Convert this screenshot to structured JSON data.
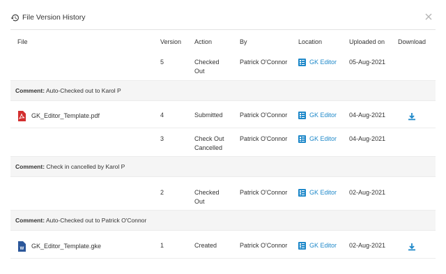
{
  "dialog": {
    "title": "File Version History"
  },
  "table": {
    "columns": [
      "File",
      "Version",
      "Action",
      "By",
      "Location",
      "Uploaded on",
      "Download"
    ],
    "rows": [
      {
        "file": "",
        "version": "5",
        "action_line1": "Checked",
        "action_line2": "Out",
        "by": "Patrick O'Connor",
        "location": "GK Editor",
        "uploaded": "05-Aug-2021",
        "comment_label": "Comment:",
        "comment": "Auto-Checked out to Karol P"
      },
      {
        "file": "GK_Editor_Template.pdf",
        "file_type": "pdf-icon",
        "version": "4",
        "action_line1": "Submitted",
        "action_line2": "",
        "by": "Patrick O'Connor",
        "location": "GK Editor",
        "uploaded": "04-Aug-2021",
        "download": "download-icon"
      },
      {
        "file": "",
        "version": "3",
        "action_line1": "Check Out",
        "action_line2": "Cancelled",
        "by": "Patrick O'Connor",
        "location": "GK Editor",
        "uploaded": "04-Aug-2021",
        "comment_label": "Comment:",
        "comment": "Check in cancelled by Karol P"
      },
      {
        "file": "",
        "version": "2",
        "action_line1": "Checked",
        "action_line2": "Out",
        "by": "Patrick O'Connor",
        "location": "GK Editor",
        "uploaded": "02-Aug-2021",
        "comment_label": "Comment:",
        "comment": "Auto-Checked out to Patrick O'Connor"
      },
      {
        "file": "GK_Editor_Template.gke",
        "file_type": "word-icon",
        "version": "1",
        "action_line1": "Created",
        "action_line2": "",
        "by": "Patrick O'Connor",
        "location": "GK Editor",
        "uploaded": "02-Aug-2021",
        "download": "download-icon"
      }
    ]
  },
  "colors": {
    "accent": "#1e88c9",
    "pdf": "#d32f2f",
    "word": "#2b579a",
    "comment_bg": "#f5f5f5"
  }
}
